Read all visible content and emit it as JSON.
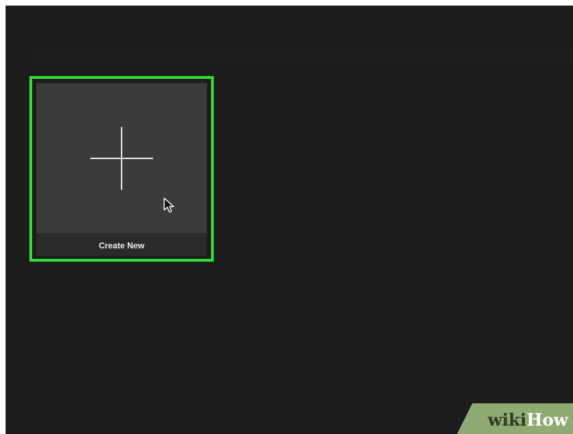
{
  "colors": {
    "background": "#1c1c1c",
    "tile_thumb": "#3b3b3b",
    "tile_footer": "#2a2a2a",
    "highlight": "#33dd33",
    "watermark_green": "#8faa72"
  },
  "create_tile": {
    "icon": "plus-icon",
    "label": "Create New"
  },
  "cursor": {
    "icon": "mouse-pointer-icon"
  },
  "watermark": {
    "part1": "wiki",
    "part2": "How"
  }
}
